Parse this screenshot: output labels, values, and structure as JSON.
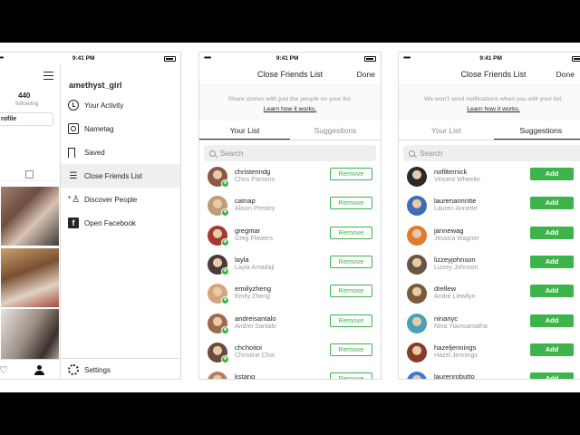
{
  "status_time": "9:41 PM",
  "signal": "•••••",
  "colors": {
    "green": "#3cb44b",
    "text": "#262626",
    "muted": "#999999"
  },
  "profile": {
    "following_count": "440",
    "following_label": "following",
    "followers_label_partial": "rs",
    "edit_button_partial": "rofile"
  },
  "menu": {
    "username": "amethyst_girl",
    "items": [
      {
        "label": "Your Activity",
        "icon": "activity-icon"
      },
      {
        "label": "Nametag",
        "icon": "nametag-icon"
      },
      {
        "label": "Saved",
        "icon": "saved-icon"
      },
      {
        "label": "Close Friends List",
        "icon": "close-friends-icon"
      },
      {
        "label": "Discover People",
        "icon": "add-person-icon"
      },
      {
        "label": "Open Facebook",
        "icon": "facebook-icon"
      }
    ],
    "settings_label": "Settings"
  },
  "your_list_screen": {
    "title": "Close Friends List",
    "done": "Done",
    "info": "Share stories with just the people on your list.",
    "link": "Learn how it works.",
    "tabs": [
      "Your List",
      "Suggestions"
    ],
    "search_placeholder": "Search",
    "button_label": "Remove",
    "rows": [
      {
        "username": "christenndg",
        "name": "Chris Parsons",
        "avatar_color": "#8a5a44"
      },
      {
        "username": "catnap",
        "name": "Alison Presley",
        "avatar_color": "#c19a78"
      },
      {
        "username": "gregmar",
        "name": "Greg Flowers",
        "avatar_color": "#a33a30"
      },
      {
        "username": "layla",
        "name": "Layla Amadaji",
        "avatar_color": "#4a3a3a"
      },
      {
        "username": "emiilyzheng",
        "name": "Emily Zheng",
        "avatar_color": "#d4a57c"
      },
      {
        "username": "andreisantalo",
        "name": "Andrei Santalo",
        "avatar_color": "#9c6b4e"
      },
      {
        "username": "chchoitoi",
        "name": "Christine Choi",
        "avatar_color": "#6b4a3a"
      },
      {
        "username": "kstang",
        "name": "",
        "avatar_color": "#b07e5c"
      }
    ]
  },
  "suggestions_screen": {
    "title": "Close Friends List",
    "done": "Done",
    "info": "We won't send notifications when you edit your list.",
    "link": "Learn how it works.",
    "tabs": [
      "Your List",
      "Suggestions"
    ],
    "search_placeholder": "Search",
    "button_label": "Add",
    "rows": [
      {
        "username": "nofilternick",
        "name": "Vincent Wheeler",
        "avatar_color": "#2a2a2a"
      },
      {
        "username": "laurenannntte",
        "name": "Lauren Annette",
        "avatar_color": "#3b6db5"
      },
      {
        "username": "jannewag",
        "name": "Jessica Wagner",
        "avatar_color": "#e07a2c"
      },
      {
        "username": "lizzeyjohnson",
        "name": "Lizzey Johnson",
        "avatar_color": "#6a5442"
      },
      {
        "username": "drellew",
        "name": "André Llewllyn",
        "avatar_color": "#7a5a3a"
      },
      {
        "username": "ninanyc",
        "name": "Nina Yiamsamatha",
        "avatar_color": "#4aa0b8"
      },
      {
        "username": "hazeljennings",
        "name": "Hazel Jennings",
        "avatar_color": "#8a3a2a"
      },
      {
        "username": "laurenrobutto",
        "name": "",
        "avatar_color": "#3a7ad0"
      }
    ]
  }
}
